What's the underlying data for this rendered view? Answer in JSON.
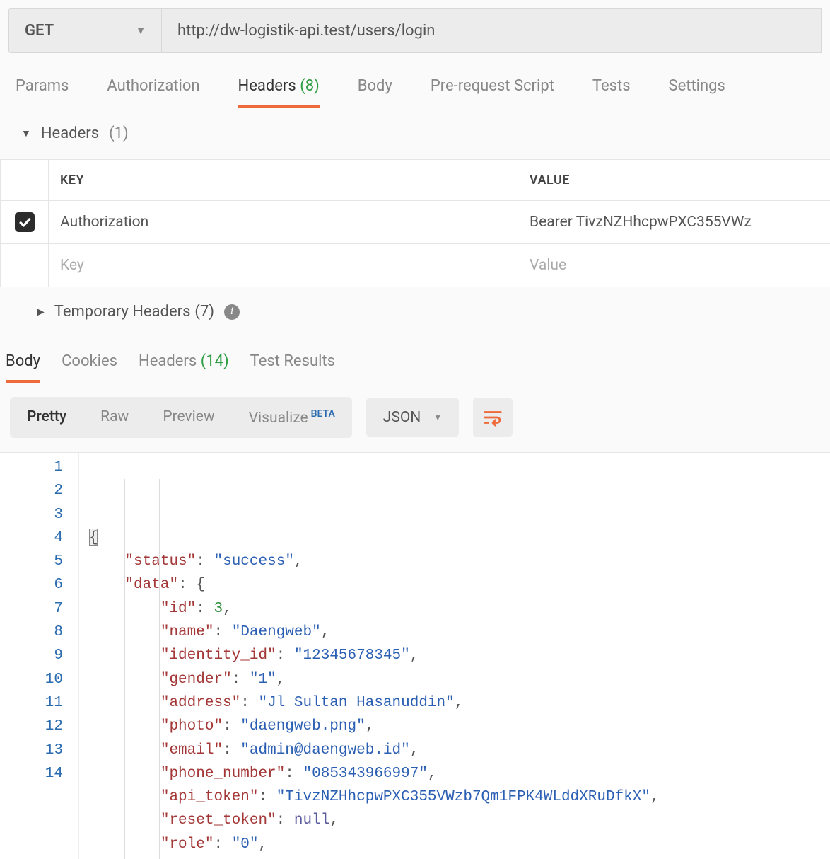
{
  "request": {
    "method": "GET",
    "url": "http://dw-logistik-api.test/users/login"
  },
  "request_tabs": {
    "params": "Params",
    "authorization": "Authorization",
    "headers": "Headers",
    "headers_count": "(8)",
    "body": "Body",
    "prescript": "Pre-request Script",
    "tests": "Tests",
    "settings": "Settings"
  },
  "headers_section": {
    "title": "Headers",
    "count": "(1)",
    "columns": {
      "key": "KEY",
      "value": "VALUE"
    },
    "rows": [
      {
        "checked": true,
        "key": "Authorization",
        "value": "Bearer TivzNZHhcpwPXC355VWz"
      }
    ],
    "placeholder_key": "Key",
    "placeholder_value": "Value",
    "temp_title": "Temporary Headers",
    "temp_count": "(7)"
  },
  "response_tabs": {
    "body": "Body",
    "cookies": "Cookies",
    "headers": "Headers",
    "headers_count": "(14)",
    "tests": "Test Results"
  },
  "response_toolbar": {
    "pretty": "Pretty",
    "raw": "Raw",
    "preview": "Preview",
    "visualize": "Visualize",
    "visualize_badge": "BETA",
    "format": "JSON"
  },
  "response_body": {
    "status_key": "status",
    "status_val": "success",
    "data_key": "data",
    "id_key": "id",
    "id_val": "3",
    "name_key": "name",
    "name_val": "Daengweb",
    "identity_key": "identity_id",
    "identity_val": "12345678345",
    "gender_key": "gender",
    "gender_val": "1",
    "address_key": "address",
    "address_val": "Jl Sultan Hasanuddin",
    "photo_key": "photo",
    "photo_val": "daengweb.png",
    "email_key": "email",
    "email_val": "admin@daengweb.id",
    "phone_key": "phone_number",
    "phone_val": "085343966997",
    "token_key": "api_token",
    "token_val": "TivzNZHhcpwPXC355VWzb7Qm1FPK4WLddXRuDfkX",
    "reset_key": "reset_token",
    "reset_val": "null",
    "role_key": "role",
    "role_val": "0"
  },
  "line_numbers": [
    "1",
    "2",
    "3",
    "4",
    "5",
    "6",
    "7",
    "8",
    "9",
    "10",
    "11",
    "12",
    "13",
    "14"
  ]
}
